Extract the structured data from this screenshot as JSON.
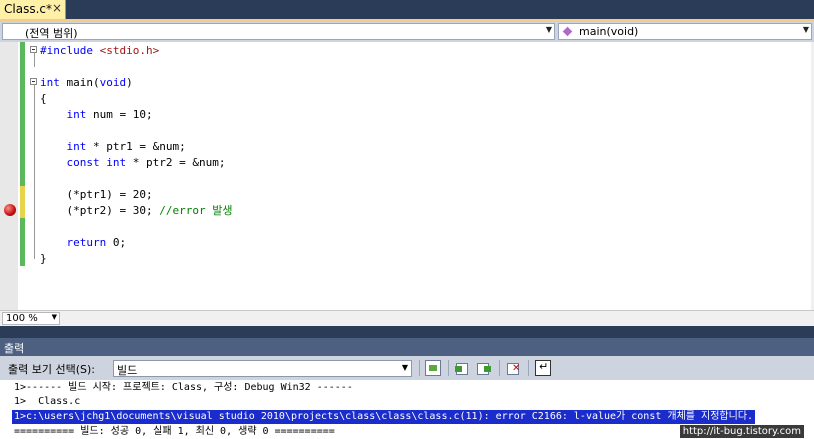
{
  "tab": {
    "title": "Class.c*",
    "close_glyph": "×"
  },
  "navigation": {
    "scope": "(전역 범위)",
    "member": "main(void)",
    "member_icon": "method-icon"
  },
  "editor": {
    "lines": [
      [
        {
          "t": "#include ",
          "c": "pp"
        },
        {
          "t": "<stdio.h>",
          "c": "str"
        }
      ],
      [],
      [
        {
          "t": "int",
          "c": "kw"
        },
        {
          "t": " main(",
          "c": ""
        },
        {
          "t": "void",
          "c": "kw"
        },
        {
          "t": ")",
          "c": ""
        }
      ],
      [
        {
          "t": "{",
          "c": ""
        }
      ],
      [
        {
          "t": "    ",
          "c": ""
        },
        {
          "t": "int",
          "c": "kw"
        },
        {
          "t": " num = 10;",
          "c": ""
        }
      ],
      [],
      [
        {
          "t": "    ",
          "c": ""
        },
        {
          "t": "int",
          "c": "kw"
        },
        {
          "t": " * ptr1 = &num;",
          "c": ""
        }
      ],
      [
        {
          "t": "    ",
          "c": ""
        },
        {
          "t": "const",
          "c": "kw"
        },
        {
          "t": " ",
          "c": ""
        },
        {
          "t": "int",
          "c": "kw"
        },
        {
          "t": " * ptr2 = &num;",
          "c": ""
        }
      ],
      [],
      [
        {
          "t": "    (*ptr1) = 20;",
          "c": ""
        }
      ],
      [
        {
          "t": "    (*ptr2) = 30; ",
          "c": ""
        },
        {
          "t": "//error 발생",
          "c": "cm"
        }
      ],
      [],
      [
        {
          "t": "    ",
          "c": ""
        },
        {
          "t": "return",
          "c": "kw"
        },
        {
          "t": " 0;",
          "c": ""
        }
      ],
      [
        {
          "t": "}",
          "c": ""
        }
      ]
    ],
    "breakpoint_line": 11
  },
  "zoom": {
    "value": "100 %"
  },
  "output": {
    "title": "출력",
    "show_label": "출력 보기 선택(S):",
    "source": "빌드",
    "lines": [
      "1>------ 빌드 시작: 프로젝트: Class, 구성: Debug Win32 ------",
      "1>  Class.c",
      "1>c:\\users\\jchg1\\documents\\visual studio 2010\\projects\\class\\class\\class.c(11): error C2166: l-value가 const 개체를 지정합니다.",
      "========== 빌드: 성공 0, 실패 1, 최신 0, 생략 0 =========="
    ],
    "selected_line": 3
  },
  "watermark": "http://it-bug.tistory.com",
  "colors": {
    "keyword": "#0000ff",
    "string": "#a31515",
    "comment": "#008000",
    "selection": "#1a2ccc",
    "frame": "#2b3c59"
  }
}
